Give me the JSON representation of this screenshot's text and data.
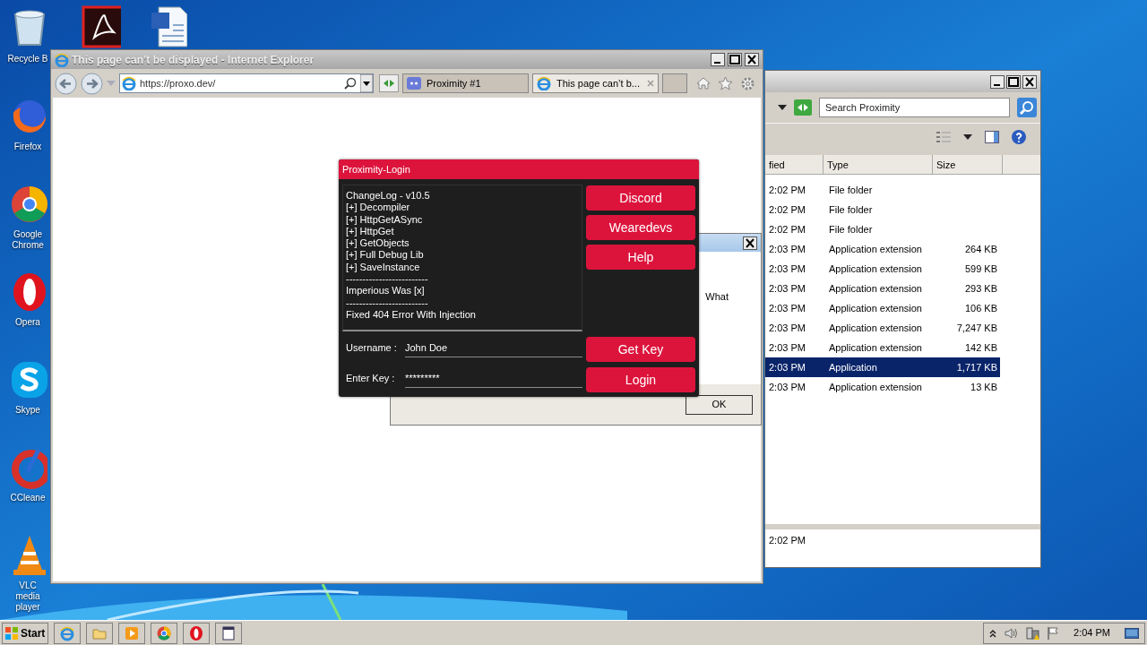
{
  "desktop_icons": [
    {
      "kind": "recycle",
      "label": "Recycle B"
    },
    {
      "kind": "acrobat"
    },
    {
      "kind": "word"
    },
    {
      "kind": "firefox",
      "label": "Firefox"
    },
    {
      "kind": "chrome",
      "label": "Google Chrome"
    },
    {
      "kind": "opera",
      "label": "Opera"
    },
    {
      "kind": "skype",
      "label": "Skype"
    },
    {
      "kind": "ccleaner",
      "label": "CCleane"
    },
    {
      "kind": "vlc",
      "label": "VLC media player"
    }
  ],
  "explorer_window": {
    "search": {
      "placeholder": "Search Proximity"
    },
    "columns": [
      "fied",
      "Type",
      "Size"
    ],
    "rows": [
      {
        "column_1": "2:02 PM",
        "type": "File folder",
        "selected": false
      },
      {
        "column_1": "2:02 PM",
        "type": "File folder",
        "selected": false
      },
      {
        "column_1": "2:02 PM",
        "type": "File folder",
        "selected": false
      },
      {
        "column_1": "2:03 PM",
        "type": "Application extension",
        "size": "264 KB",
        "selected": false
      },
      {
        "column_1": "2:03 PM",
        "type": "Application extension",
        "size": "599 KB",
        "selected": false
      },
      {
        "column_1": "2:03 PM",
        "type": "Application extension",
        "size": "293 KB",
        "selected": false
      },
      {
        "column_1": "2:03 PM",
        "type": "Application extension",
        "size": "106 KB",
        "selected": false
      },
      {
        "column_1": "2:03 PM",
        "type": "Application extension",
        "size": "7,247 KB",
        "selected": false
      },
      {
        "column_1": "2:03 PM",
        "type": "Application extension",
        "size": "142 KB",
        "selected": false
      },
      {
        "column_1": "2:03 PM",
        "type": "Application",
        "size": "1,717 KB",
        "selected": true
      },
      {
        "column_1": "2:03 PM",
        "type": "Application extension",
        "size": "13 KB",
        "selected": false
      }
    ],
    "details_text": "2:02 PM"
  },
  "ie_window": {
    "title": "This page can’t be displayed - Internet Explorer",
    "address": "https://proxo.dev/",
    "tabs": [
      {
        "kind": "discord",
        "label": "Proximity #1",
        "selected": false
      },
      {
        "kind": "ie",
        "label": "This page can’t b...",
        "selected": true
      }
    ]
  },
  "message_dialog": {
    "text": "What",
    "ok_button": "OK"
  },
  "login_window": {
    "title": "Proximity-Login",
    "changelog": [
      "ChangeLog - v10.5",
      "[+] Decompiler",
      "[+] HttpGetASync",
      "[+] HttpGet",
      "[+] GetObjects",
      "[+] Full Debug Lib",
      "[+] SaveInstance",
      "-------------------------",
      "Imperious Was [x]",
      "-------------------------",
      "Fixed 404 Error With Injection"
    ],
    "side_buttons": [
      "Discord",
      "Wearedevs",
      "Help"
    ],
    "fields": [
      {
        "label": "Username :",
        "value": "John Doe"
      },
      {
        "label": "Enter Key :",
        "value": "*********"
      }
    ],
    "action_buttons": [
      "Get Key",
      "Login"
    ]
  },
  "taskbar": {
    "start": "Start",
    "apps": [
      {
        "kind": "ie"
      },
      {
        "kind": "folder"
      },
      {
        "kind": "media"
      },
      {
        "kind": "chrome"
      },
      {
        "kind": "opera"
      },
      {
        "kind": "window"
      }
    ],
    "clock": "2:04 PM"
  }
}
